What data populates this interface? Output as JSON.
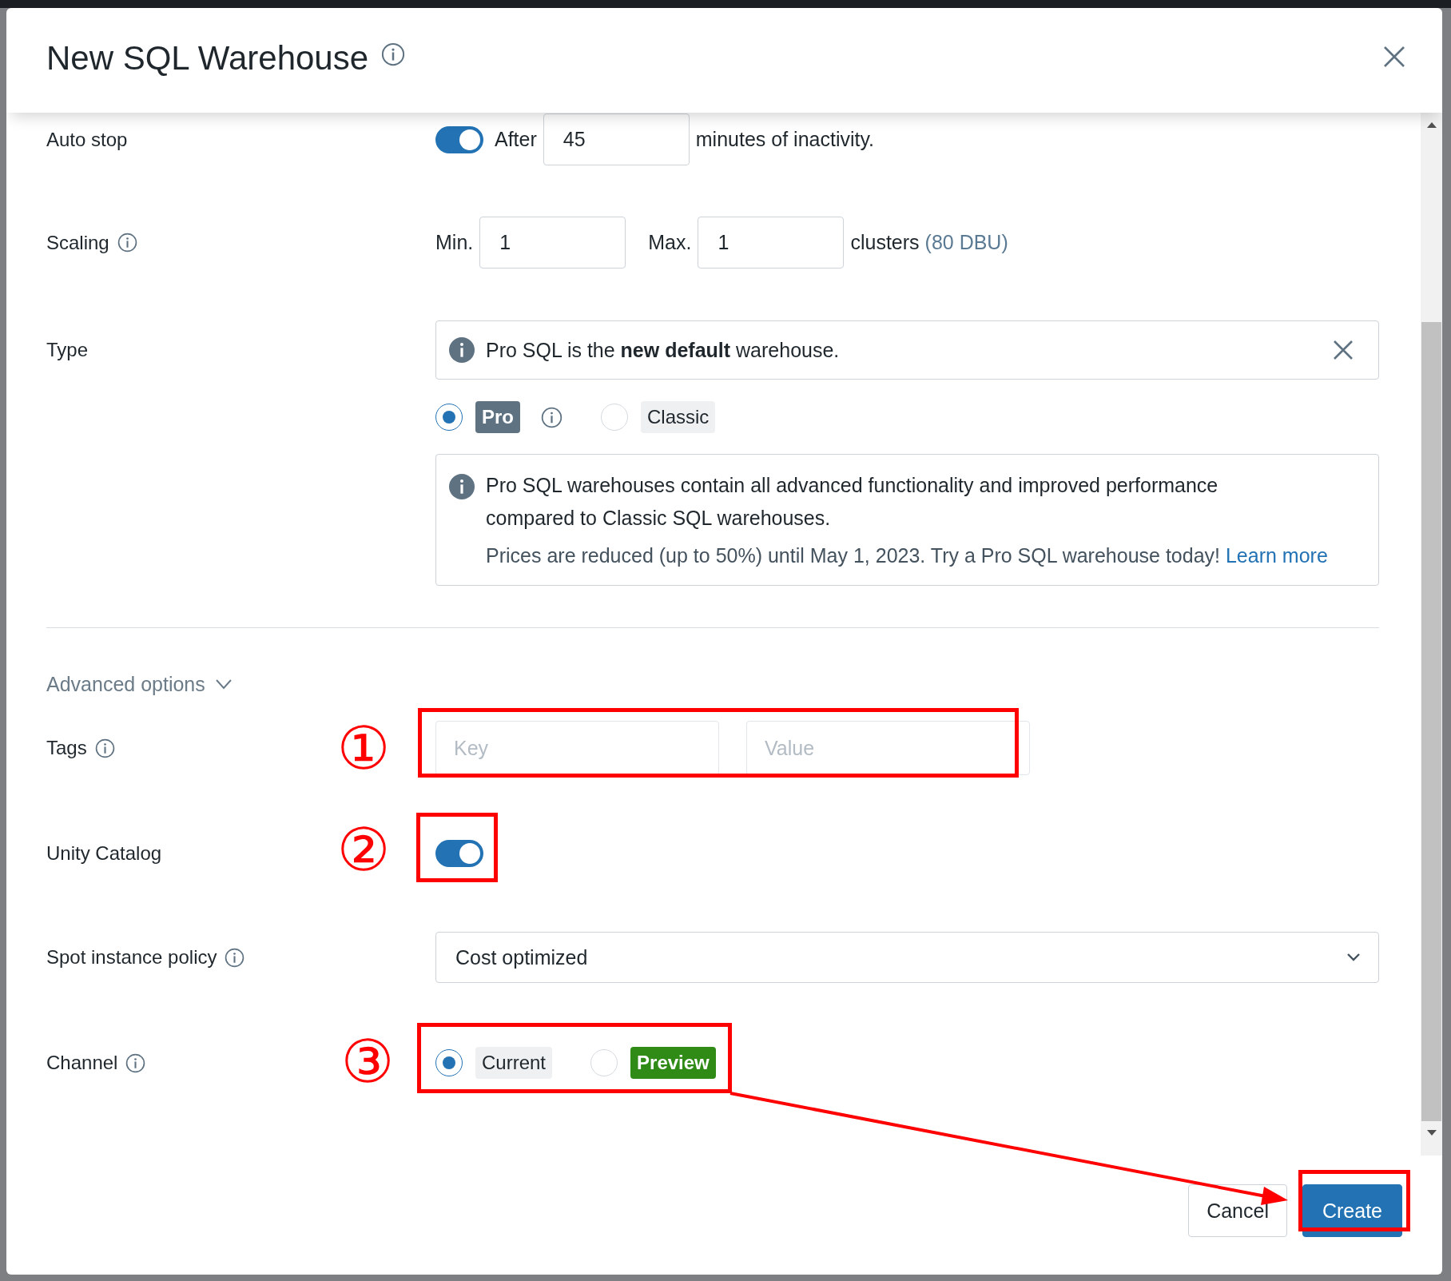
{
  "dialog": {
    "title": "New SQL Warehouse"
  },
  "auto_stop": {
    "label": "Auto stop",
    "on": true,
    "prefix": "After",
    "value": "45",
    "suffix": "minutes of inactivity."
  },
  "scaling": {
    "label": "Scaling",
    "min_label": "Min.",
    "min": "1",
    "max_label": "Max.",
    "max": "1",
    "unit": "clusters",
    "dbu": "(80 DBU)"
  },
  "type": {
    "label": "Type",
    "notice": "Pro SQL is the **new default** warehouse.",
    "options": [
      {
        "label": "Pro",
        "selected": true,
        "kind": "dark"
      },
      {
        "label": "Classic",
        "selected": false,
        "kind": "light"
      }
    ],
    "info": "Pro SQL warehouses contain all advanced functionality and improved performance compared to Classic SQL warehouses.",
    "note": "Prices are reduced (up to 50%) until May 1, 2023. Try a Pro SQL warehouse today!",
    "link": "Learn more"
  },
  "advanced_options": {
    "label": "Advanced options",
    "expanded": true
  },
  "tags": {
    "label": "Tags",
    "key_placeholder": "Key",
    "value_placeholder": "Value"
  },
  "unity_catalog": {
    "label": "Unity Catalog",
    "on": true
  },
  "spot_instance_policy": {
    "label": "Spot instance policy",
    "value": "Cost optimized"
  },
  "channel": {
    "label": "Channel",
    "options": [
      {
        "label": "Current",
        "selected": true,
        "kind": "light"
      },
      {
        "label": "Preview",
        "selected": false,
        "kind": "green"
      }
    ]
  },
  "buttons": [
    {
      "label": "Cancel",
      "kind": "secondary"
    },
    {
      "label": "Create",
      "kind": "primary"
    }
  ],
  "annotations": [
    {
      "label": "①"
    },
    {
      "label": "②"
    },
    {
      "label": "③"
    }
  ]
}
